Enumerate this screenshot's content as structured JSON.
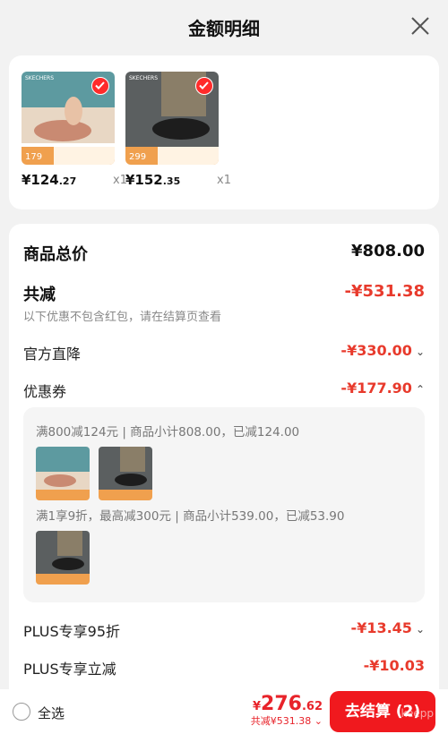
{
  "header": {
    "title": "金额明细"
  },
  "products": [
    {
      "price_int": "¥124",
      "price_dec": ".27",
      "qty": "x1",
      "tag": "179",
      "brand": "SKECHERS"
    },
    {
      "price_int": "¥152",
      "price_dec": ".35",
      "qty": "x1",
      "tag": "299",
      "brand": "SKECHERS"
    }
  ],
  "summary": {
    "total_label": "商品总价",
    "total_value": "¥808.00",
    "reduce_label": "共减",
    "reduce_value": "-¥531.38",
    "note": "以下优惠不包含红包，请在结算页查看",
    "official_label": "官方直降",
    "official_value": "-¥330.00",
    "coupon_label": "优惠券",
    "coupon_value": "-¥177.90",
    "plus95_label": "PLUS专享95折",
    "plus95_value": "-¥13.45",
    "plus_direct_label": "PLUS专享立减",
    "plus_direct_value": "-¥10.03"
  },
  "coupons": [
    {
      "text": "满800减124元 | 商品小计808.00，已减124.00"
    },
    {
      "text": "满1享9折，最高减300元 | 商品小计539.00，已减53.90"
    }
  ],
  "bottom": {
    "select_all": "全选",
    "symbol": "¥",
    "amount_int": "276",
    "amount_dec": ".62",
    "saved": "共减¥531.38",
    "checkout": "去结算 (2)",
    "watermark": "keepp"
  },
  "colors": {
    "accent": "#f0191e",
    "discount": "#e83a2c",
    "background": "#f2f2f2"
  }
}
